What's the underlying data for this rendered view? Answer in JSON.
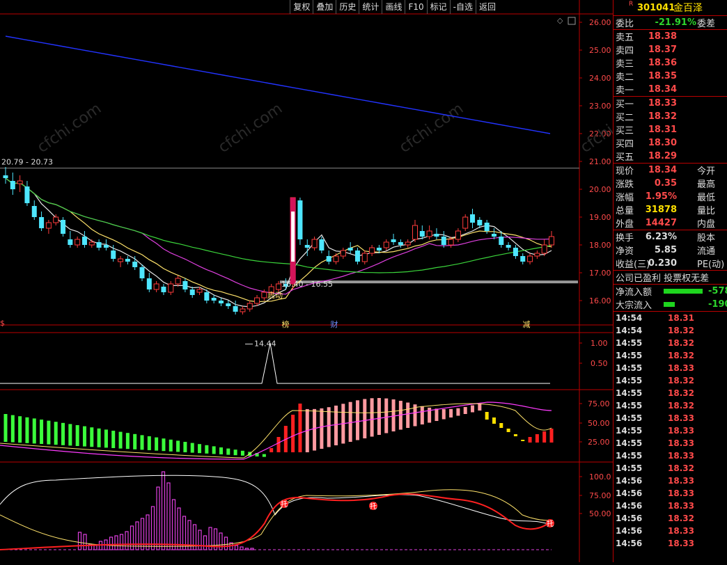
{
  "toolbar": {
    "items": [
      "复权",
      "叠加",
      "历史",
      "统计",
      "画线",
      "F10",
      "标记",
      "-自选",
      "返回"
    ]
  },
  "chart_data": {
    "type": "candlestick",
    "price_axis_ticks": [
      "26.00",
      "25.00",
      "24.00",
      "23.00",
      "22.00",
      "21.00",
      "20.00",
      "19.00",
      "18.00",
      "17.00",
      "16.00"
    ],
    "ylim": [
      15.3,
      26.3
    ],
    "annotations": {
      "high_range": "20.79 - 20.73",
      "low_range": "16.40 - 16.55",
      "low_point": "14.44",
      "start_label": "启动"
    },
    "event_markers": [
      "榜",
      "财",
      "减"
    ],
    "candles": [
      {
        "o": 20.5,
        "h": 20.8,
        "l": 20.2,
        "c": 20.4
      },
      {
        "o": 20.3,
        "h": 20.6,
        "l": 19.8,
        "c": 20.0
      },
      {
        "o": 20.2,
        "h": 20.5,
        "l": 19.9,
        "c": 20.3
      },
      {
        "o": 20.1,
        "h": 20.3,
        "l": 19.4,
        "c": 19.5
      },
      {
        "o": 19.4,
        "h": 19.6,
        "l": 18.9,
        "c": 19.0
      },
      {
        "o": 19.0,
        "h": 19.2,
        "l": 18.5,
        "c": 18.6
      },
      {
        "o": 18.6,
        "h": 18.9,
        "l": 18.4,
        "c": 18.8
      },
      {
        "o": 18.8,
        "h": 19.1,
        "l": 18.7,
        "c": 19.0
      },
      {
        "o": 18.9,
        "h": 19.0,
        "l": 18.3,
        "c": 18.4
      },
      {
        "o": 18.2,
        "h": 18.5,
        "l": 17.9,
        "c": 18.0
      },
      {
        "o": 18.0,
        "h": 18.3,
        "l": 17.9,
        "c": 18.2
      },
      {
        "o": 18.3,
        "h": 18.5,
        "l": 17.9,
        "c": 18.0
      },
      {
        "o": 18.0,
        "h": 18.2,
        "l": 17.9,
        "c": 18.1
      },
      {
        "o": 18.1,
        "h": 18.2,
        "l": 17.8,
        "c": 17.9
      },
      {
        "o": 18.0,
        "h": 18.2,
        "l": 17.8,
        "c": 17.9
      },
      {
        "o": 17.8,
        "h": 18.0,
        "l": 17.4,
        "c": 17.5
      },
      {
        "o": 17.4,
        "h": 17.6,
        "l": 17.2,
        "c": 17.5
      },
      {
        "o": 17.5,
        "h": 17.6,
        "l": 17.3,
        "c": 17.4
      },
      {
        "o": 17.4,
        "h": 17.6,
        "l": 17.1,
        "c": 17.2
      },
      {
        "o": 17.2,
        "h": 17.3,
        "l": 16.7,
        "c": 16.8
      },
      {
        "o": 16.8,
        "h": 17.0,
        "l": 16.3,
        "c": 16.4
      },
      {
        "o": 16.4,
        "h": 16.7,
        "l": 16.3,
        "c": 16.6
      },
      {
        "o": 16.5,
        "h": 16.6,
        "l": 16.2,
        "c": 16.3
      },
      {
        "o": 16.3,
        "h": 16.7,
        "l": 16.2,
        "c": 16.6
      },
      {
        "o": 16.6,
        "h": 16.9,
        "l": 16.5,
        "c": 16.8
      },
      {
        "o": 16.7,
        "h": 16.8,
        "l": 16.3,
        "c": 16.4
      },
      {
        "o": 16.4,
        "h": 16.5,
        "l": 16.1,
        "c": 16.2
      },
      {
        "o": 16.3,
        "h": 16.5,
        "l": 16.2,
        "c": 16.4
      },
      {
        "o": 16.3,
        "h": 16.4,
        "l": 15.9,
        "c": 16.0
      },
      {
        "o": 16.1,
        "h": 16.2,
        "l": 15.9,
        "c": 16.0
      },
      {
        "o": 16.0,
        "h": 16.1,
        "l": 15.8,
        "c": 15.9
      },
      {
        "o": 15.9,
        "h": 16.0,
        "l": 15.7,
        "c": 15.8
      },
      {
        "o": 15.8,
        "h": 16.0,
        "l": 15.5,
        "c": 15.6
      },
      {
        "o": 15.6,
        "h": 15.8,
        "l": 15.5,
        "c": 15.7
      },
      {
        "o": 15.7,
        "h": 16.0,
        "l": 15.6,
        "c": 15.9
      },
      {
        "o": 15.9,
        "h": 16.2,
        "l": 15.8,
        "c": 16.1
      },
      {
        "o": 16.1,
        "h": 16.4,
        "l": 16.0,
        "c": 16.3
      },
      {
        "o": 16.3,
        "h": 16.6,
        "l": 16.2,
        "c": 16.5
      },
      {
        "o": 16.4,
        "h": 16.7,
        "l": 16.3,
        "c": 16.6
      },
      {
        "o": 16.6,
        "h": 16.8,
        "l": 16.4,
        "c": 16.5
      },
      {
        "o": 16.6,
        "h": 19.7,
        "l": 16.4,
        "c": 19.7
      },
      {
        "o": 19.6,
        "h": 19.7,
        "l": 18.0,
        "c": 18.2
      },
      {
        "o": 18.0,
        "h": 18.2,
        "l": 17.6,
        "c": 17.9
      },
      {
        "o": 17.9,
        "h": 18.3,
        "l": 17.8,
        "c": 18.2
      },
      {
        "o": 18.2,
        "h": 18.3,
        "l": 17.7,
        "c": 17.8
      },
      {
        "o": 17.6,
        "h": 17.8,
        "l": 17.3,
        "c": 17.4
      },
      {
        "o": 17.4,
        "h": 17.7,
        "l": 17.3,
        "c": 17.6
      },
      {
        "o": 17.6,
        "h": 17.9,
        "l": 17.5,
        "c": 17.8
      },
      {
        "o": 17.9,
        "h": 18.1,
        "l": 17.7,
        "c": 17.8
      },
      {
        "o": 17.8,
        "h": 17.9,
        "l": 17.3,
        "c": 17.4
      },
      {
        "o": 17.4,
        "h": 17.8,
        "l": 17.3,
        "c": 17.7
      },
      {
        "o": 17.7,
        "h": 18.0,
        "l": 17.6,
        "c": 17.9
      },
      {
        "o": 17.9,
        "h": 18.0,
        "l": 17.7,
        "c": 17.8
      },
      {
        "o": 17.9,
        "h": 18.2,
        "l": 17.8,
        "c": 18.1
      },
      {
        "o": 18.2,
        "h": 18.4,
        "l": 18.0,
        "c": 18.1
      },
      {
        "o": 18.1,
        "h": 18.2,
        "l": 17.9,
        "c": 18.0
      },
      {
        "o": 18.0,
        "h": 18.2,
        "l": 17.9,
        "c": 18.1
      },
      {
        "o": 18.2,
        "h": 18.9,
        "l": 18.1,
        "c": 18.7
      },
      {
        "o": 18.5,
        "h": 18.7,
        "l": 18.2,
        "c": 18.3
      },
      {
        "o": 18.3,
        "h": 18.7,
        "l": 18.2,
        "c": 18.5
      },
      {
        "o": 18.4,
        "h": 18.6,
        "l": 18.2,
        "c": 18.3
      },
      {
        "o": 18.3,
        "h": 18.5,
        "l": 17.9,
        "c": 18.0
      },
      {
        "o": 18.0,
        "h": 18.3,
        "l": 17.9,
        "c": 18.2
      },
      {
        "o": 18.2,
        "h": 18.6,
        "l": 18.1,
        "c": 18.5
      },
      {
        "o": 18.6,
        "h": 19.1,
        "l": 18.5,
        "c": 19.0
      },
      {
        "o": 19.1,
        "h": 19.3,
        "l": 18.6,
        "c": 18.8
      },
      {
        "o": 18.9,
        "h": 19.0,
        "l": 18.6,
        "c": 18.7
      },
      {
        "o": 18.8,
        "h": 18.9,
        "l": 18.4,
        "c": 18.5
      },
      {
        "o": 18.4,
        "h": 18.6,
        "l": 18.2,
        "c": 18.3
      },
      {
        "o": 18.3,
        "h": 18.5,
        "l": 17.9,
        "c": 18.0
      },
      {
        "o": 18.0,
        "h": 18.1,
        "l": 17.8,
        "c": 17.9
      },
      {
        "o": 17.9,
        "h": 18.0,
        "l": 17.5,
        "c": 17.6
      },
      {
        "o": 17.6,
        "h": 17.7,
        "l": 17.3,
        "c": 17.4
      },
      {
        "o": 17.4,
        "h": 17.7,
        "l": 17.3,
        "c": 17.6
      },
      {
        "o": 17.6,
        "h": 17.8,
        "l": 17.5,
        "c": 17.7
      },
      {
        "o": 17.7,
        "h": 18.2,
        "l": 17.6,
        "c": 18.0
      },
      {
        "o": 18.0,
        "h": 18.5,
        "l": 17.9,
        "c": 18.3
      }
    ],
    "indicator1_ticks": [
      "1.00",
      "0.50"
    ],
    "indicator2_ticks": [
      "75.00",
      "50.00",
      "25.00"
    ],
    "indicator3_ticks": [
      "100.0",
      "75.00",
      "50.00"
    ],
    "indicator3_labels": [
      "托",
      "托",
      "托"
    ]
  },
  "quote": {
    "code": "301041",
    "name": "金百泽",
    "flag": "R",
    "weibi_label": "委比",
    "weibi_value": "-21.91%",
    "weicha_label": "委差",
    "sells": [
      {
        "label": "卖五",
        "price": "18.38"
      },
      {
        "label": "卖四",
        "price": "18.37"
      },
      {
        "label": "卖三",
        "price": "18.36"
      },
      {
        "label": "卖二",
        "price": "18.35"
      },
      {
        "label": "卖一",
        "price": "18.34"
      }
    ],
    "buys": [
      {
        "label": "买一",
        "price": "18.33"
      },
      {
        "label": "买二",
        "price": "18.32"
      },
      {
        "label": "买三",
        "price": "18.31"
      },
      {
        "label": "买四",
        "price": "18.30"
      },
      {
        "label": "买五",
        "price": "18.29"
      }
    ],
    "stats": [
      {
        "label": "现价",
        "value": "18.34",
        "label2": "今开",
        "color": "red"
      },
      {
        "label": "涨跌",
        "value": "0.35",
        "label2": "最高",
        "color": "red"
      },
      {
        "label": "涨幅",
        "value": "1.95%",
        "label2": "最低",
        "color": "red"
      },
      {
        "label": "总量",
        "value": "31878",
        "label2": "量比",
        "color": "yellow"
      },
      {
        "label": "外盘",
        "value": "14427",
        "label2": "内盘",
        "color": "red"
      }
    ],
    "stats2": [
      {
        "label": "换手",
        "value": "6.23%",
        "label2": "股本"
      },
      {
        "label": "净资",
        "value": "5.85",
        "label2": "流通"
      },
      {
        "label": "收益(三)",
        "value": "0.230",
        "label2": "PE(动)"
      }
    ],
    "profit_line": "公司已盈利 投票权无差",
    "flows": [
      {
        "label": "净流入额",
        "value": "-578",
        "bar": 0.7
      },
      {
        "label": "大宗流入",
        "value": "-190",
        "bar": 0.2
      }
    ],
    "ticks": [
      {
        "time": "14:54",
        "price": "18.31"
      },
      {
        "time": "14:54",
        "price": "18.32"
      },
      {
        "time": "14:55",
        "price": "18.32"
      },
      {
        "time": "14:55",
        "price": "18.32"
      },
      {
        "time": "14:55",
        "price": "18.33"
      },
      {
        "time": "14:55",
        "price": "18.32"
      },
      {
        "time": "14:55",
        "price": "18.32"
      },
      {
        "time": "14:55",
        "price": "18.32"
      },
      {
        "time": "14:55",
        "price": "18.33"
      },
      {
        "time": "14:55",
        "price": "18.33"
      },
      {
        "time": "14:55",
        "price": "18.33"
      },
      {
        "time": "14:55",
        "price": "18.33"
      },
      {
        "time": "14:55",
        "price": "18.32"
      },
      {
        "time": "14:56",
        "price": "18.33"
      },
      {
        "time": "14:56",
        "price": "18.33"
      },
      {
        "time": "14:56",
        "price": "18.33"
      },
      {
        "time": "14:56",
        "price": "18.32"
      },
      {
        "time": "14:56",
        "price": "18.33"
      },
      {
        "time": "14:56",
        "price": "18.33"
      }
    ]
  }
}
